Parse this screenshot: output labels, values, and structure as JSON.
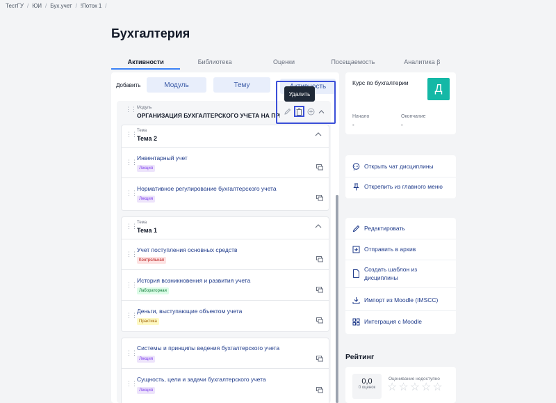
{
  "breadcrumb": [
    "ТестГУ",
    "ЮИ",
    "Бух.учет",
    "!Поток 1"
  ],
  "page_title": "Бухгалтерия",
  "tabs": [
    {
      "label": "Активности",
      "active": true
    },
    {
      "label": "Библиотека",
      "active": false
    },
    {
      "label": "Оценки",
      "active": false
    },
    {
      "label": "Посещаемость",
      "active": false
    },
    {
      "label": "Аналитика β",
      "active": false
    }
  ],
  "add_bar": {
    "label": "Добавить",
    "module_btn": "Модуль",
    "topic_btn": "Тему",
    "activity_btn": "Активность"
  },
  "tooltip": "Удалить",
  "module": {
    "sub": "Модуль",
    "title": "ОРГАНИЗАЦИЯ БУХГАЛТЕРСКОГО УЧЕТА НА ПРЕ…"
  },
  "topics": [
    {
      "sub": "Тема",
      "title": "Тема 2",
      "items": [
        {
          "title": "Инвентарный учет",
          "tag": "Лекция"
        },
        {
          "title": "Нормативное регулирование бухгалтерского учета",
          "tag": "Лекция"
        }
      ]
    },
    {
      "sub": "Тема",
      "title": "Тема 1",
      "items": [
        {
          "title": "Учет поступления основных средств",
          "tag": "Контрольная"
        },
        {
          "title": "История возникновения и развития учета",
          "tag": "Лабораторная"
        },
        {
          "title": "Деньги, выступающие объектом учета",
          "tag": "Практика"
        }
      ]
    }
  ],
  "loose_items": [
    {
      "title": "Системы и принципы ведения бухгалтерского учета",
      "tag": "Лекция"
    },
    {
      "title": "Сущность, цели и задачи бухгалтерского учета",
      "tag": "Лекция"
    }
  ],
  "course": {
    "title": "Курс по бухгалтерии",
    "avatar_letter": "Д",
    "start_label": "Начало",
    "start_value": "-",
    "end_label": "Окончание",
    "end_value": "-"
  },
  "quick_actions": [
    {
      "label": "Открыть чат дисциплины",
      "icon": "chat-icon"
    },
    {
      "label": "Открепить из главного меню",
      "icon": "pin-icon"
    }
  ],
  "actions": [
    {
      "label": "Редактировать",
      "icon": "pencil-icon"
    },
    {
      "label": "Отправить в архив",
      "icon": "archive-icon"
    },
    {
      "label": "Создать шаблон из дисциплины",
      "icon": "template-icon"
    },
    {
      "label": "Импорт из Moodle (IMSCC)",
      "icon": "download-icon"
    },
    {
      "label": "Интеграция с Moodle",
      "icon": "grid-icon"
    }
  ],
  "rating": {
    "title": "Рейтинг",
    "score": "0,0",
    "count_label": "0 оценок",
    "unavailable": "Оценивание недоступно",
    "stars": 5
  },
  "colors": {
    "accent": "#3b82f6",
    "highlight": "#3b4fd8",
    "avatar_bg": "#14b8a6"
  }
}
